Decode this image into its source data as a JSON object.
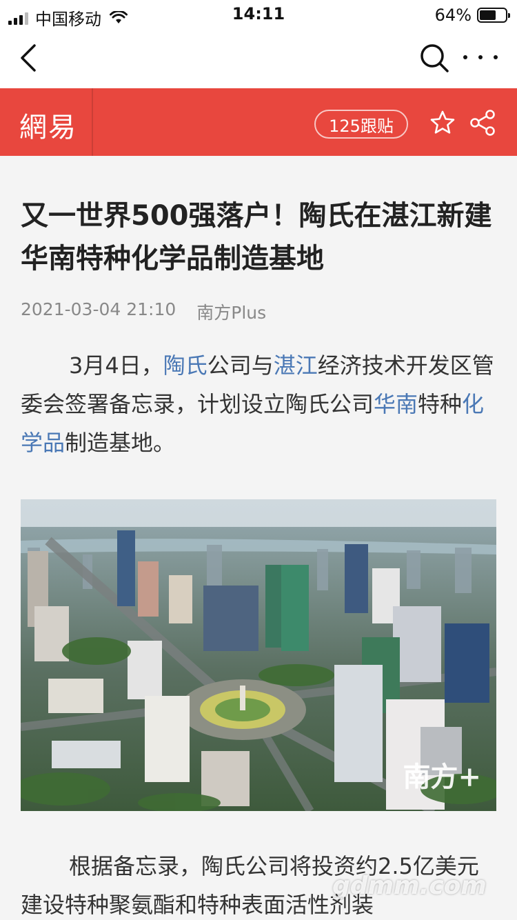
{
  "status_bar": {
    "carrier": "中国移动",
    "time": "14:11",
    "battery_pct": "64%",
    "battery_level": 0.64,
    "icons": [
      "signal-icon",
      "wifi-icon",
      "battery-icon"
    ]
  },
  "browser_nav": {
    "icons": [
      "back-arrow-icon",
      "search-icon",
      "more-icon"
    ]
  },
  "site_header": {
    "logo": "網易",
    "comments_label": "125跟贴",
    "icons": [
      "star-icon",
      "share-icon"
    ],
    "brand_color": "#e8473e"
  },
  "article": {
    "title": "又一世界500强落户！陶氏在湛江新建华南特种化学品制造基地",
    "date": "2021-03-04 21:10",
    "source": "南方Plus",
    "para1": {
      "t1": "3月4日，",
      "link1": "陶氏",
      "t2": "公司与",
      "link2": "湛江",
      "t3": "经济技术开发区管委会签署备忘录，计划设立陶氏公司",
      "link3": "华南",
      "t4": "特种",
      "link4": "化学品",
      "t5": "制造基地。"
    },
    "photo_watermark": "南方+",
    "para2": "根据备忘录，陶氏公司将投资约2.5亿美元建设特种聚氨酯和特种表面活性剂装"
  },
  "site_watermark": "gdmm.com",
  "colors": {
    "link": "#4a78b5",
    "background": "#f4f4f4"
  }
}
